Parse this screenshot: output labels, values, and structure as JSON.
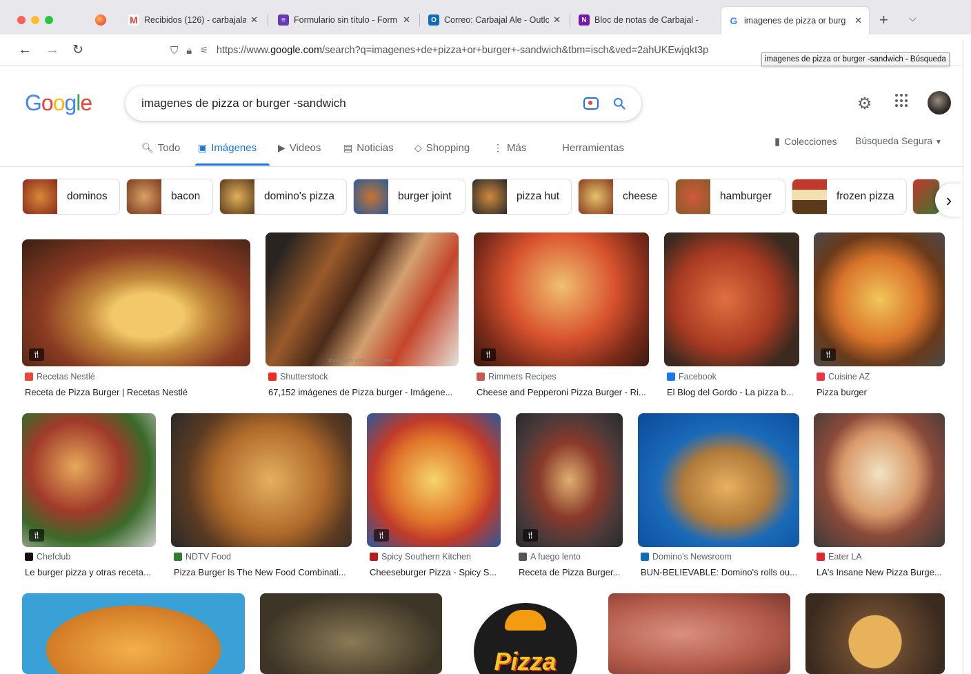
{
  "browser": {
    "tabs": [
      {
        "title": "Recibidos (126) - carbajalal",
        "favicon_color": "#ea4335",
        "favicon": "M"
      },
      {
        "title": "Formulario sin título - Form",
        "favicon_color": "#673ab7",
        "favicon": "≡"
      },
      {
        "title": "Correo: Carbajal Ale - Outlo",
        "favicon_color": "#0f6cbd",
        "favicon": "O"
      },
      {
        "title": "Bloc de notas de Carbajal -",
        "favicon_color": "#7719aa",
        "favicon": "N"
      },
      {
        "title": "imagenes de pizza or burg",
        "favicon_color": "#4285f4",
        "favicon": "G",
        "active": true
      }
    ],
    "url_prefix": "https://www.",
    "url_host": "google.com",
    "url_path": "/search?q=imagenes+de+pizza+or+burger+-sandwich&tbm=isch&ved=2ahUKEwjqkt3p",
    "tooltip": "imagenes de pizza or burger -sandwich - Búsqueda"
  },
  "google": {
    "logo_letters": [
      {
        "ch": "G",
        "color": "#4285f4"
      },
      {
        "ch": "o",
        "color": "#ea4335"
      },
      {
        "ch": "o",
        "color": "#fbbc05"
      },
      {
        "ch": "g",
        "color": "#4285f4"
      },
      {
        "ch": "l",
        "color": "#34a853"
      },
      {
        "ch": "e",
        "color": "#ea4335"
      }
    ],
    "query": "imagenes de pizza or burger -sandwich",
    "tabs": {
      "todo": "Todo",
      "imagenes": "Imágenes",
      "videos": "Videos",
      "noticias": "Noticias",
      "shopping": "Shopping",
      "mas": "Más",
      "herramientas": "Herramientas"
    },
    "colecciones": "Colecciones",
    "busqueda_segura": "Búsqueda Segura",
    "chips": [
      "dominos",
      "bacon",
      "domino's pizza",
      "burger joint",
      "pizza hut",
      "cheese",
      "hamburger",
      "frozen pizza"
    ],
    "results": [
      {
        "source": "Recetas Nestlé",
        "title": "Receta de Pizza Burger | Recetas Nestlé",
        "src_color": "#e8453c"
      },
      {
        "source": "Shutterstock",
        "title": "67,152 imágenes de Pizza burger - Imágene...",
        "src_color": "#ee2b24",
        "watermark": "shutterstock.com · 470627828"
      },
      {
        "source": "Rimmers Recipes",
        "title": "Cheese and Pepperoni Pizza Burger - Ri...",
        "src_color": "#c65a4c"
      },
      {
        "source": "Facebook",
        "title": "El Blog del Gordo - La pizza b...",
        "src_color": "#1877f2"
      },
      {
        "source": "Cuisine AZ",
        "title": "Pizza burger",
        "src_color": "#e63946"
      },
      {
        "source": "Chefclub",
        "title": "Le burger pizza y otras receta...",
        "src_color": "#111111"
      },
      {
        "source": "NDTV Food",
        "title": "Pizza Burger Is The New Food Combinati...",
        "src_color": "#2e7d32"
      },
      {
        "source": "Spicy Southern Kitchen",
        "title": "Cheeseburger Pizza - Spicy S...",
        "src_color": "#b71c1c"
      },
      {
        "source": "A fuego lento",
        "title": "Receta de Pizza Burger...",
        "src_color": "#555555"
      },
      {
        "source": "Domino's Newsroom",
        "title": "BUN-BELIEVABLE: Domino's rolls ou...",
        "src_color": "#0b6fb8"
      },
      {
        "source": "Eater LA",
        "title": "LA's Insane New Pizza Burge...",
        "src_color": "#e0282e"
      }
    ],
    "logo_text": "Pizza"
  }
}
